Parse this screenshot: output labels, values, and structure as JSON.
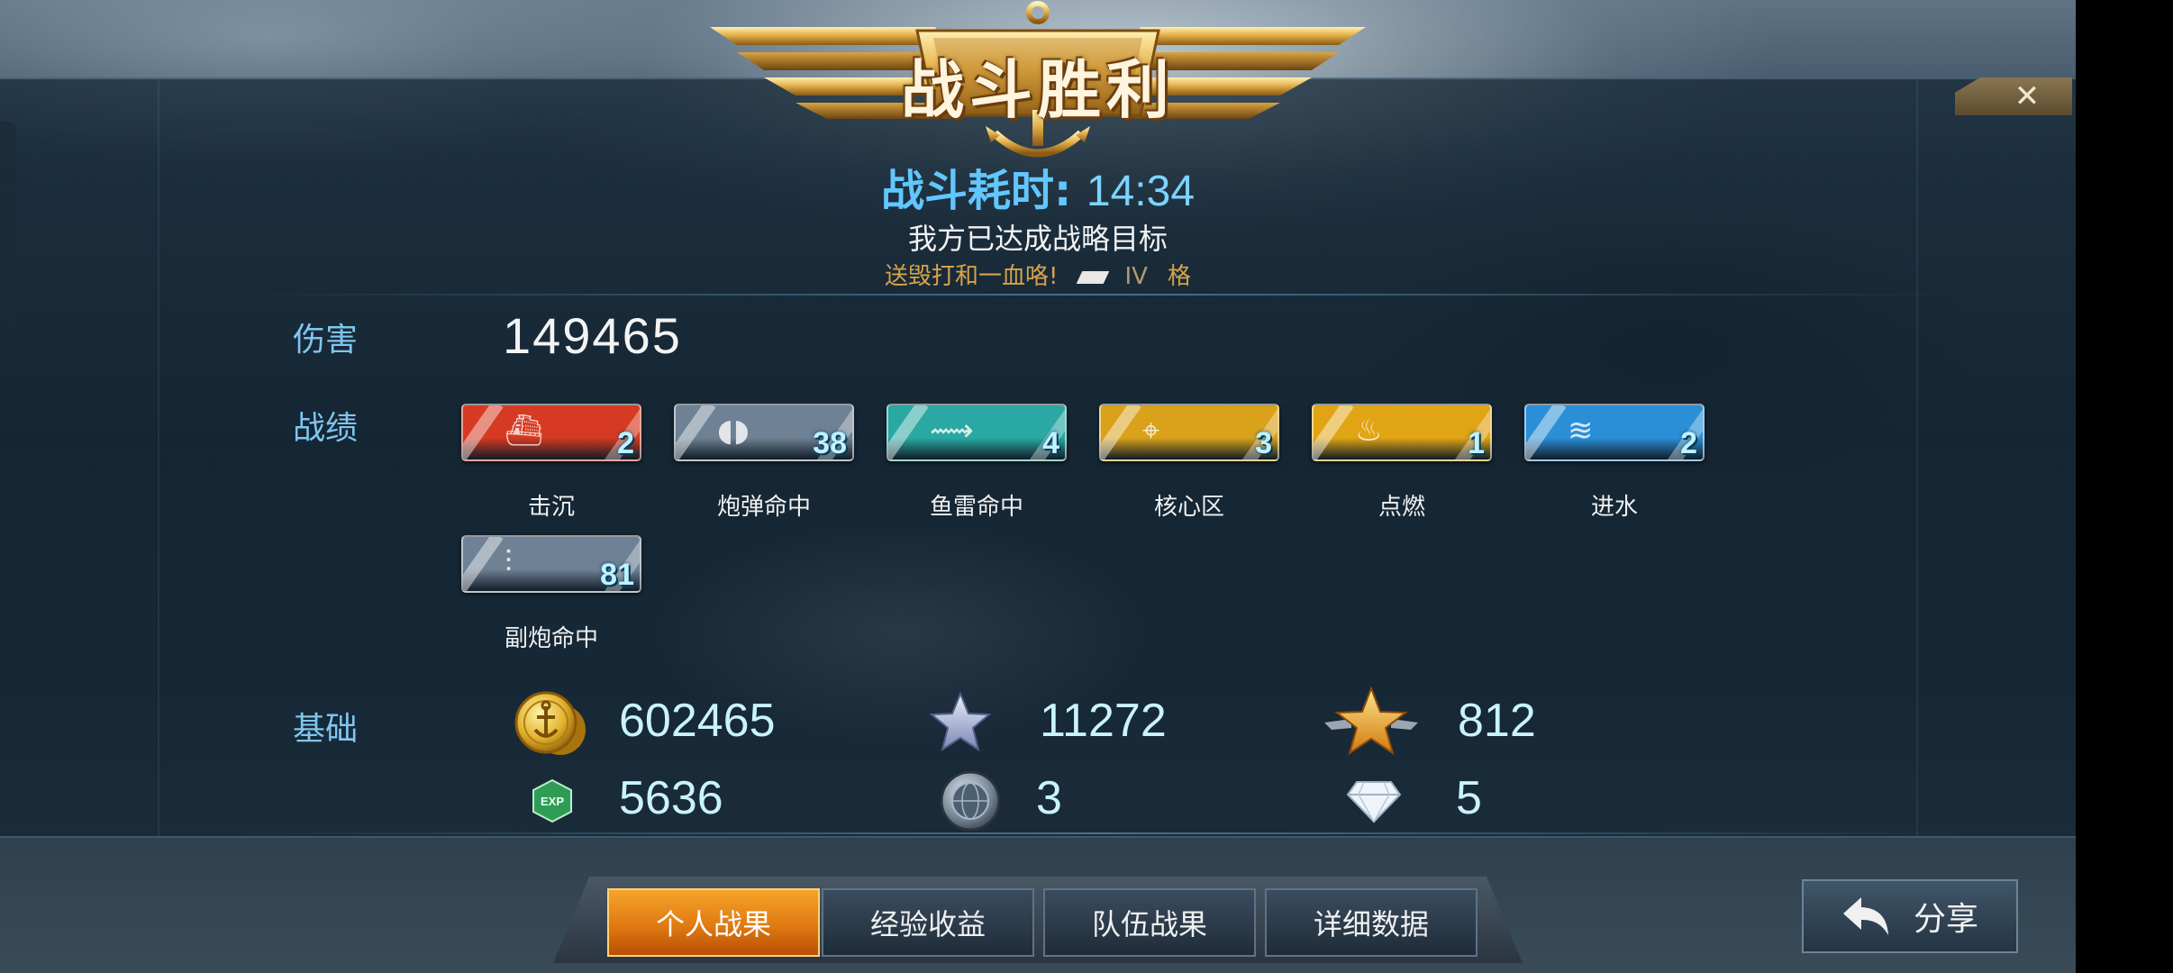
{
  "header": {
    "title": "战斗胜利",
    "duration_label": "战斗耗时:",
    "duration_value": "14:34",
    "objective": "我方已达成战略目标",
    "message": "送毁打和一血咯!",
    "tier": "IV",
    "suffix": "格"
  },
  "close": {
    "label": "✕"
  },
  "damage": {
    "label": "伤害",
    "value": "149465"
  },
  "achievements": {
    "label": "战绩",
    "items": [
      {
        "label": "击沉",
        "count": "2",
        "color": "#d63a22",
        "icon": "sinking-ship-icon",
        "glyph": "⛴"
      },
      {
        "label": "炮弹命中",
        "count": "38",
        "color": "#6f8194",
        "icon": "shell-hit-icon",
        "glyph": "◖◗"
      },
      {
        "label": "鱼雷命中",
        "count": "4",
        "color": "#2aa8a3",
        "icon": "torpedo-icon",
        "glyph": "⟿"
      },
      {
        "label": "核心区",
        "count": "3",
        "color": "#d9a21a",
        "icon": "citadel-icon",
        "glyph": "⌖"
      },
      {
        "label": "点燃",
        "count": "1",
        "color": "#e0a414",
        "icon": "fire-icon",
        "glyph": "♨"
      },
      {
        "label": "进水",
        "count": "2",
        "color": "#2a8fd6",
        "icon": "flooding-icon",
        "glyph": "≋"
      },
      {
        "label": "副炮命中",
        "count": "81",
        "color": "#6f8194",
        "icon": "secondary-battery-icon",
        "glyph": "⫶"
      }
    ]
  },
  "base": {
    "label": "基础",
    "rewards": [
      {
        "icon": "gold-coin-icon",
        "value": "602465"
      },
      {
        "icon": "silver-star-icon",
        "value": "11272"
      },
      {
        "icon": "gold-star-icon",
        "value": "812"
      },
      {
        "icon": "exp-icon",
        "value": "5636",
        "icon_text": "EXP"
      },
      {
        "icon": "globe-medal-icon",
        "value": "3"
      },
      {
        "icon": "diamond-icon",
        "value": "5"
      }
    ]
  },
  "tabs": [
    {
      "label": "个人战果",
      "active": true
    },
    {
      "label": "经验收益",
      "active": false
    },
    {
      "label": "队伍战果",
      "active": false
    },
    {
      "label": "详细数据",
      "active": false
    }
  ],
  "share": {
    "label": "分享"
  },
  "colors": {
    "accent_blue": "#61c7ff",
    "value_text": "#c9f3ff",
    "active_tab": "#e07a12",
    "gold": "#d9a21a"
  }
}
